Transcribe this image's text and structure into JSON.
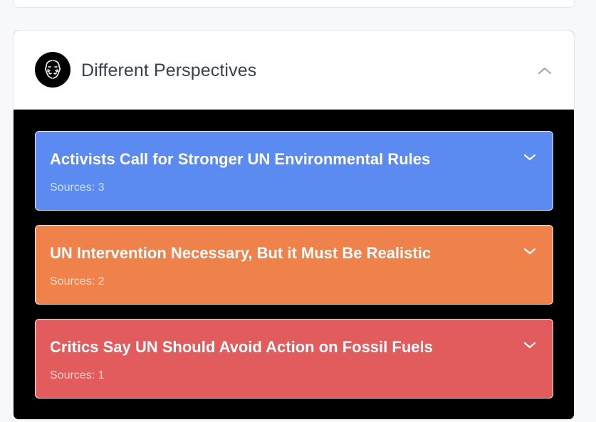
{
  "section": {
    "title": "Different Perspectives",
    "logo_icon": "masks-icon",
    "collapse_icon": "chevron-up-icon"
  },
  "perspectives": [
    {
      "title": "Activists Call for Stronger UN Environmental Rules",
      "sources": "Sources: 3",
      "color": "#5b8af0",
      "expand_icon": "chevron-down-icon"
    },
    {
      "title": "UN Intervention Necessary, But it Must Be Realistic",
      "sources": "Sources: 2",
      "color": "#ee824a",
      "expand_icon": "chevron-down-icon"
    },
    {
      "title": "Critics Say UN Should Avoid Action on Fossil Fuels",
      "sources": "Sources: 1",
      "color": "#e25b5d",
      "expand_icon": "chevron-down-icon"
    }
  ]
}
